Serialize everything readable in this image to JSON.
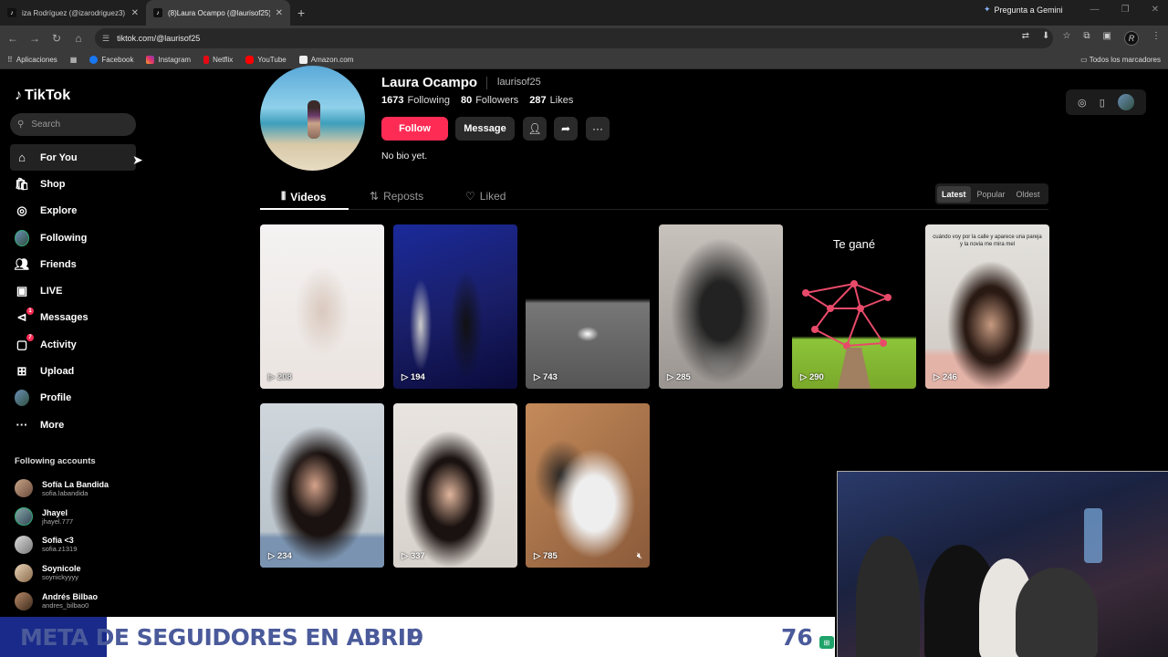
{
  "browser": {
    "tabs": [
      {
        "title": "iza Rodríguez (@izarodriguez3)"
      },
      {
        "title": "(8)Laura Ocampo (@laurisof25)"
      }
    ],
    "gemini": "Pregunta a Gemini",
    "url": "tiktok.com/@laurisof25",
    "bookmarks": [
      "Aplicaciones",
      "Facebook",
      "Instagram",
      "Netflix",
      "YouTube",
      "Amazon.com"
    ],
    "all_bookmarks": "Todos los marcadores"
  },
  "tiktok": {
    "logo": "TikTok",
    "search_placeholder": "Search",
    "menu": [
      {
        "label": "For You"
      },
      {
        "label": "Shop"
      },
      {
        "label": "Explore"
      },
      {
        "label": "Following"
      },
      {
        "label": "Friends"
      },
      {
        "label": "LIVE"
      },
      {
        "label": "Messages",
        "badge": "1"
      },
      {
        "label": "Activity",
        "badge": "7"
      },
      {
        "label": "Upload"
      },
      {
        "label": "Profile"
      },
      {
        "label": "More"
      }
    ],
    "following_header": "Following accounts",
    "following": [
      {
        "name": "Sofía La Bandida",
        "handle": "sofia.labandida"
      },
      {
        "name": "Jhayel",
        "handle": "jhayel.777"
      },
      {
        "name": "Sofia <3",
        "handle": "sofia.z1319"
      },
      {
        "name": "Soynicole",
        "handle": "soynickyyyy"
      },
      {
        "name": "Andrés Bilbao",
        "handle": "andres_bilbao0"
      }
    ]
  },
  "profile": {
    "name": "Laura Ocampo",
    "handle": "laurisof25",
    "following": "1673",
    "following_label": "Following",
    "followers": "80",
    "followers_label": "Followers",
    "likes": "287",
    "likes_label": "Likes",
    "follow_button": "Follow",
    "message_button": "Message",
    "bio": "No bio yet.",
    "tabs": [
      "Videos",
      "Reposts",
      "Liked"
    ],
    "sort": [
      "Latest",
      "Popular",
      "Oldest"
    ],
    "videos": [
      {
        "views": "208"
      },
      {
        "views": "194"
      },
      {
        "views": "743"
      },
      {
        "views": "285"
      },
      {
        "views": "290",
        "text": "Te gané"
      },
      {
        "views": "246",
        "text": "cuándo voy por la calle y aparece una pareja y la novia me mira mel"
      },
      {
        "views": "234"
      },
      {
        "views": "337"
      },
      {
        "views": "785"
      }
    ]
  },
  "overlay": {
    "banner_text": "META DE SEGUIDORES EN ABRIL",
    "banner_num1": "9",
    "banner_num2": "76"
  }
}
